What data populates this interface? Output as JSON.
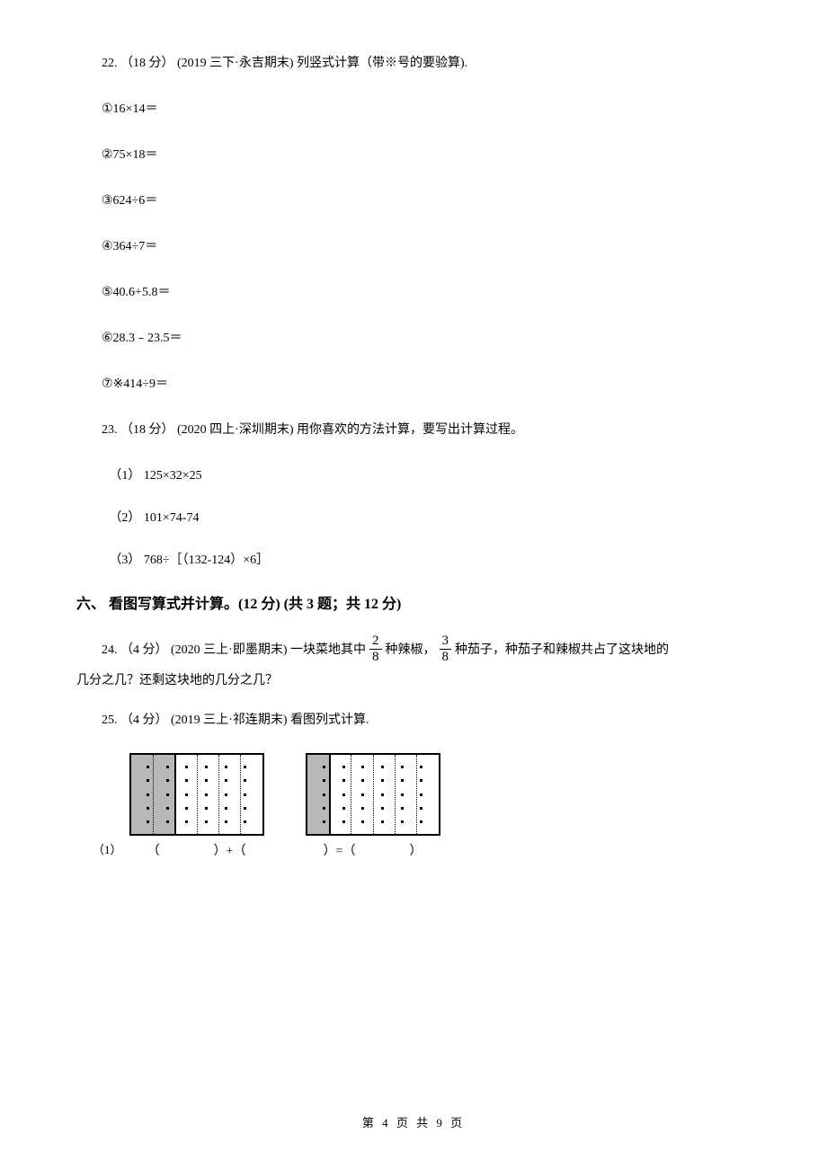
{
  "q22": {
    "header": "22. （18 分） (2019 三下·永吉期末) 列竖式计算（带※号的要验算).",
    "items": [
      "①16×14＝",
      "②75×18＝",
      "③624÷6＝",
      "④364÷7＝",
      "⑤40.6+5.8＝",
      "⑥28.3﹣23.5＝",
      "⑦※414÷9＝"
    ]
  },
  "q23": {
    "header": "23. （18 分） (2020 四上·深圳期末) 用你喜欢的方法计算，要写出计算过程。",
    "items": [
      "（1） 125×32×25",
      "（2） 101×74-74",
      "（3） 768÷［（132-124）×6］"
    ]
  },
  "section6": "六、 看图写算式并计算。(12 分)  (共 3 题；共 12 分)",
  "q24": {
    "lead": "24. （4 分） (2020 三上·即墨期末) 一块菜地其中 ",
    "frac1_num": "2",
    "frac1_den": "8",
    "mid1": " 种辣椒，",
    "frac2_num": "3",
    "frac2_den": "8",
    "mid2": " 种茄子，种茄子和辣椒共占了这块地的",
    "line2": "几分之几？还剩这块地的几分之几？"
  },
  "q25": {
    "header": "25. （4 分） (2019 三上·祁连期末) 看图列式计算.",
    "sub_label": "（1）",
    "expr_left_open": "（",
    "expr_left_close": "）+（",
    "expr_right_eq": "）=（",
    "expr_right_close": "）"
  },
  "footer": "第 4 页 共 9 页"
}
